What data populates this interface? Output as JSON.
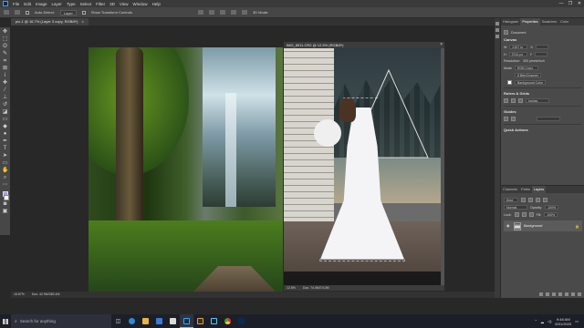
{
  "menubar": {
    "items": [
      "File",
      "Edit",
      "Image",
      "Layer",
      "Type",
      "Select",
      "Filter",
      "3D",
      "View",
      "Window",
      "Help"
    ],
    "window_controls": [
      "—",
      "❐",
      "✕"
    ]
  },
  "options_bar": {
    "auto_select": "Auto-Select:",
    "auto_select_target": "Layer",
    "transform_controls": "Show Transform Controls",
    "mode_3d": "3D Mode:"
  },
  "tab": {
    "title": "pic-1 @ 16.7% (Layer 3 copy, RGB/8*)",
    "close": "×"
  },
  "docwin": {
    "title": "IMG_8911.CR2 @ 12.5% (RGB/8*)",
    "close": "×",
    "zoom": "12.5%",
    "doc_info": "Doc: 74.0M/74.0M"
  },
  "main_status": {
    "zoom": "16.67%",
    "doc_info": "Doc: 42.9M/382.4M"
  },
  "right_panel": {
    "tabs": [
      "Histogram",
      "Properties",
      "Swatches",
      "Color"
    ],
    "active_tab": "Properties",
    "document_label": "Document",
    "canvas": {
      "title": "Canvas",
      "width_label": "W",
      "width_value": "2107 in",
      "height_label": "H",
      "height_value": "3744 px",
      "x_label": "X",
      "y_label": "Y",
      "resolution_label": "Resolution:",
      "resolution_value": "300 pixels/inch",
      "mode_label": "Mode",
      "mode_value": "RGB Color",
      "depth_value": "8 Bits/Channel",
      "fill_value": "Background Color"
    },
    "rulers_grids": {
      "title": "Rulers & Grids",
      "unit": "Inches"
    },
    "guides": {
      "title": "Guides"
    },
    "quick_actions": {
      "title": "Quick Actions"
    }
  },
  "layers_panel": {
    "tabs": [
      "Channels",
      "Paths",
      "Layers"
    ],
    "active_tab": "Layers",
    "kind": "Kind",
    "blend_mode": "Normal",
    "opacity_label": "Opacity:",
    "opacity_value": "100%",
    "lock_label": "Lock:",
    "fill_label": "Fill:",
    "fill_value": "100%",
    "layers": [
      {
        "name": "Background",
        "visible": true,
        "locked": true
      }
    ]
  },
  "taskbar": {
    "search_placeholder": "Search for anything",
    "time": "9:48 AM",
    "date": "8/31/2020",
    "icons": [
      "task-view-icon",
      "edge-icon",
      "file-explorer-icon",
      "store-icon",
      "mail-icon",
      "photoshop-icon",
      "bridge-icon",
      "lightroom-icon",
      "chrome-icon",
      "camera-raw-icon"
    ]
  }
}
